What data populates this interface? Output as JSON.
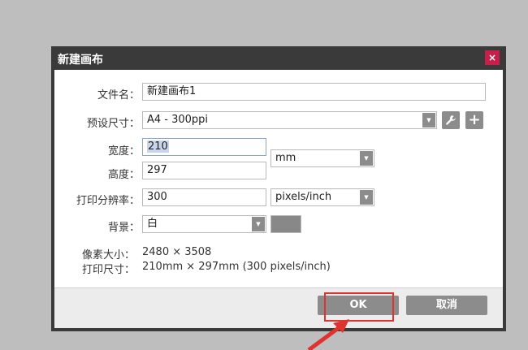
{
  "dialog": {
    "title": "新建画布",
    "close_glyph": "×",
    "close_icon": "close-icon"
  },
  "form": {
    "filename_label": "文件名：",
    "filename_value": "新建画布1",
    "preset_label": "预设尺寸：",
    "preset_value": "A4 - 300ppi",
    "width_label": "宽度：",
    "width_value": "210",
    "height_label": "高度：",
    "height_value": "297",
    "unit_value": "mm",
    "resolution_label": "打印分辨率：",
    "resolution_value": "300",
    "resolution_unit": "pixels/inch",
    "background_label": "背景：",
    "background_value": "白",
    "background_swatch_color": "#888888",
    "wrench_glyph": "🔧",
    "plus_glyph": "+"
  },
  "info": {
    "pixel_size_label": "像素大小：",
    "pixel_size_value": "2480 × 3508",
    "print_size_label": "打印尺寸：",
    "print_size_value": "210mm × 297mm (300 pixels/inch)"
  },
  "buttons": {
    "ok_label": "OK",
    "cancel_label": "取消"
  },
  "annotation": {
    "highlight_color": "#e0322e"
  }
}
